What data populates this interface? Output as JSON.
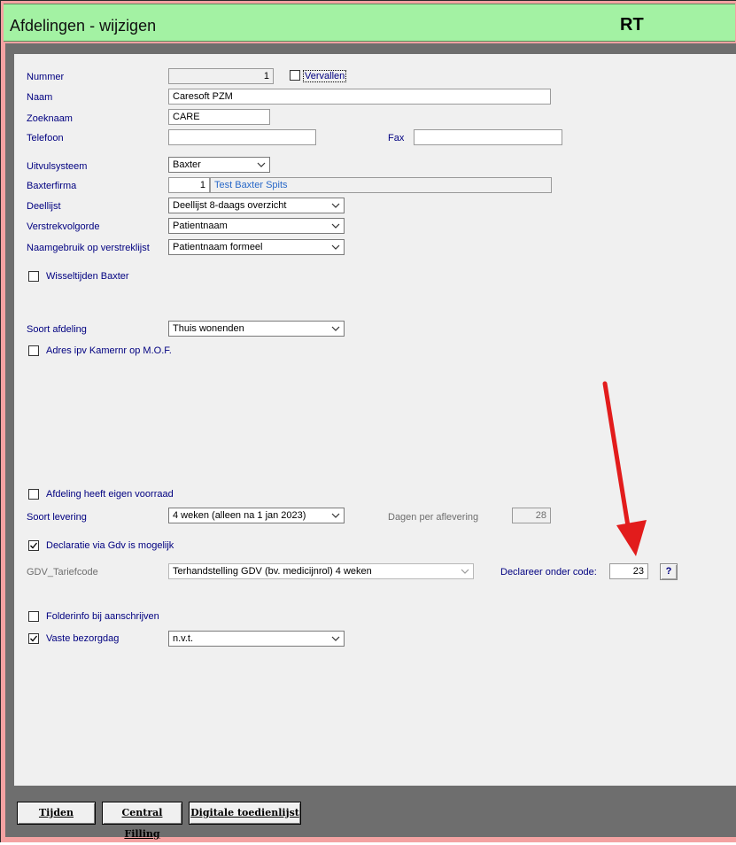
{
  "window": {
    "title": "Afdelingen - wijzigen",
    "code": "RT"
  },
  "form": {
    "nummer": {
      "label": "Nummer",
      "value": "1"
    },
    "vervallen": {
      "label": "Vervallen",
      "checked": false
    },
    "naam": {
      "label": "Naam",
      "value": "Caresoft PZM"
    },
    "zoeknaam": {
      "label": "Zoeknaam",
      "value": "CARE"
    },
    "telefoon": {
      "label": "Telefoon",
      "value": ""
    },
    "fax": {
      "label": "Fax",
      "value": ""
    },
    "uitvulsysteem": {
      "label": "Uitvulsysteem",
      "value": "Baxter"
    },
    "baxterfirma": {
      "label": "Baxterfirma",
      "value": "1",
      "name": "Test Baxter Spits"
    },
    "deellijst": {
      "label": "Deellijst",
      "value": "Deellijst 8-daags overzicht"
    },
    "verstrekvolgorde": {
      "label": "Verstrekvolgorde",
      "value": "Patientnaam"
    },
    "naamgebruik": {
      "label": "Naamgebruik op verstreklijst",
      "value": "Patientnaam formeel"
    },
    "wisseltijden": {
      "label": "Wisseltijden Baxter",
      "checked": false
    },
    "soort_afdeling": {
      "label": "Soort afdeling",
      "value": "Thuis wonenden"
    },
    "adres_kamernr": {
      "label": "Adres ipv Kamernr op M.O.F.",
      "checked": false
    },
    "eigen_voorraad": {
      "label": "Afdeling heeft eigen voorraad",
      "checked": false
    },
    "soort_levering": {
      "label": "Soort levering",
      "value": "4 weken (alleen na 1 jan 2023)"
    },
    "dagen_per_aflevering": {
      "label": "Dagen per aflevering",
      "value": "28"
    },
    "declaratie_gdv": {
      "label": "Declaratie via Gdv is mogelijk",
      "checked": true
    },
    "gdv_tariefcode": {
      "label": "GDV_Tariefcode",
      "value": "Terhandstelling GDV (bv. medicijnrol) 4 weken"
    },
    "declareer_code": {
      "label": "Declareer onder code:",
      "value": "23",
      "help": "?"
    },
    "folderinfo": {
      "label": "Folderinfo bij aanschrijven",
      "checked": false
    },
    "vaste_bezorgdag": {
      "label": "Vaste bezorgdag",
      "checked": true,
      "value": "n.v.t."
    }
  },
  "buttons": {
    "tijden": "Tijden",
    "central_filling": "Central Filling",
    "digitale_toedienlijst": "Digitale toedienlijst"
  },
  "colors": {
    "title_bg": "#a3f2a3",
    "frame_bg": "#f4a2a2",
    "label": "#000080",
    "annotation_arrow": "#e21c1c"
  }
}
